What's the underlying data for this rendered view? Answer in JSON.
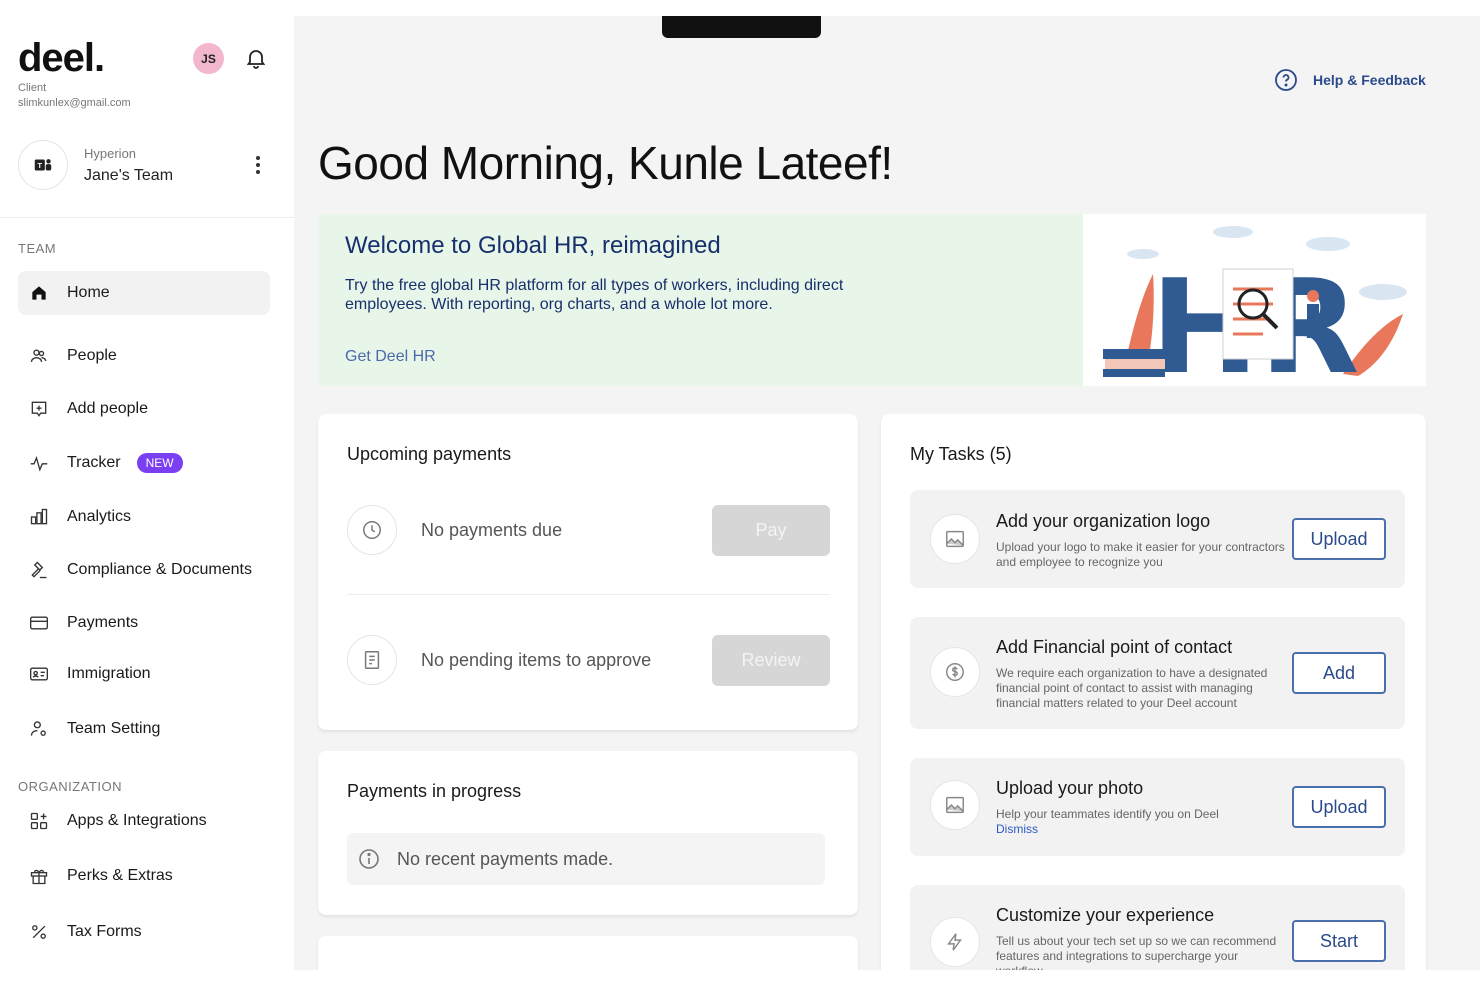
{
  "brand": {
    "logo": "deel.",
    "role": "Client",
    "email": "slimkunlex@gmail.com",
    "avatar_initials": "JS"
  },
  "team": {
    "org": "Hyperion",
    "name": "Jane's Team"
  },
  "sidebar": {
    "team_label": "TEAM",
    "org_label": "ORGANIZATION",
    "items": [
      {
        "label": "Home",
        "icon": "home-icon"
      },
      {
        "label": "People",
        "icon": "people-icon"
      },
      {
        "label": "Add people",
        "icon": "add-people-icon"
      },
      {
        "label": "Tracker",
        "icon": "activity-icon",
        "badge": "NEW"
      },
      {
        "label": "Analytics",
        "icon": "bar-chart-icon"
      },
      {
        "label": "Compliance & Documents",
        "icon": "gavel-icon"
      },
      {
        "label": "Payments",
        "icon": "card-icon"
      },
      {
        "label": "Immigration",
        "icon": "id-card-icon"
      },
      {
        "label": "Team Setting",
        "icon": "user-settings-icon"
      }
    ],
    "org_items": [
      {
        "label": "Apps & Integrations",
        "icon": "apps-icon"
      },
      {
        "label": "Perks & Extras",
        "icon": "gift-icon"
      },
      {
        "label": "Tax Forms",
        "icon": "percent-icon"
      }
    ]
  },
  "header": {
    "help_label": "Help & Feedback",
    "greeting": "Good Morning, Kunle Lateef!"
  },
  "banner": {
    "title": "Welcome to Global HR, reimagined",
    "text": "Try the free global HR platform for all types of workers, including direct employees. With reporting, org charts, and a whole lot more.",
    "link": "Get Deel HR",
    "art_letters": "HR"
  },
  "upcoming": {
    "title": "Upcoming payments",
    "row1_text": "No payments due",
    "row1_button": "Pay",
    "row2_text": "No pending items to approve",
    "row2_button": "Review"
  },
  "in_progress": {
    "title": "Payments in progress",
    "empty_text": "No recent payments made."
  },
  "tasks": {
    "title": "My Tasks (5)",
    "items": [
      {
        "title": "Add your organization logo",
        "desc": "Upload your logo to make it easier for your contractors and employee to recognize you",
        "button": "Upload"
      },
      {
        "title": "Add Financial point of contact",
        "desc": "We require each organization to have a designated financial point of contact to assist with managing financial matters related to your Deel account",
        "button": "Add"
      },
      {
        "title": "Upload your photo",
        "desc": "Help your teammates identify you on Deel",
        "link": "Dismiss",
        "button": "Upload"
      },
      {
        "title": "Customize your experience",
        "desc": "Tell us about your tech set up so we can recommend features and integrations to supercharge your workflow",
        "button": "Start"
      }
    ]
  },
  "colors": {
    "accent_purple": "#7b3ff2",
    "navy": "#17306b",
    "banner_bg": "#e8f6ea",
    "avatar_pink": "#f3b6cf"
  }
}
